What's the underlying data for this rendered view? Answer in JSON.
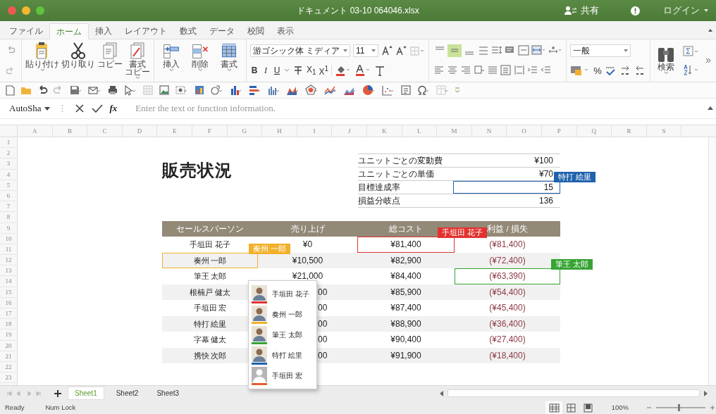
{
  "window": {
    "title": "ドキュメント 03-10 064046.xlsx",
    "share": "共有",
    "login": "ログイン"
  },
  "menu_tabs": [
    {
      "label": "ファイル",
      "selected": false
    },
    {
      "label": "ホーム",
      "selected": true
    },
    {
      "label": "挿入",
      "selected": false
    },
    {
      "label": "レイアウト",
      "selected": false
    },
    {
      "label": "数式",
      "selected": false
    },
    {
      "label": "データ",
      "selected": false
    },
    {
      "label": "校閲",
      "selected": false
    },
    {
      "label": "表示",
      "selected": false
    }
  ],
  "ribbon": {
    "clipboard": [
      {
        "lines": [
          "貼り付け"
        ]
      },
      {
        "lines": [
          "切り取り"
        ]
      },
      {
        "lines": [
          "コピー"
        ]
      },
      {
        "lines": [
          "書式",
          "コピー"
        ]
      }
    ],
    "cells": [
      "挿入",
      "削除",
      "書式"
    ],
    "font": {
      "name": "游ゴシック体 ミディア",
      "size": "11"
    },
    "text_format": [
      "B",
      "I",
      "U"
    ],
    "script_format": [
      "X$_{1}$",
      "X$^{1}$"
    ],
    "vertical_align": [
      {
        "selected": false
      },
      {
        "selected": true
      },
      {
        "selected": false
      }
    ],
    "number_format": "一般",
    "percent": "%",
    "find": "検索"
  },
  "formula_bar": {
    "name_box": "AutoSha",
    "fx": "fx",
    "placeholder": "Enter the text or function information."
  },
  "columns": [
    "A",
    "B",
    "C",
    "D",
    "E",
    "F",
    "G",
    "H",
    "I",
    "J",
    "K",
    "L",
    "M",
    "N",
    "O",
    "P",
    "Q",
    "R",
    "S"
  ],
  "rows": [
    "1",
    "2",
    "3",
    "4",
    "5",
    "6",
    "7",
    "8",
    "9",
    "10",
    "11",
    "12",
    "13",
    "14",
    "15",
    "16",
    "17",
    "18",
    "19",
    "20",
    "21",
    "22",
    "23"
  ],
  "sheet": {
    "title": "販売状況",
    "info": [
      {
        "label": "ユニットごとの変動費",
        "value": "¥100"
      },
      {
        "label": "ユニットごとの単価",
        "value": "¥70"
      },
      {
        "label": "目標達成率",
        "value": "15",
        "editor": {
          "name": "特打 絵里",
          "color": "#1e62ad"
        }
      },
      {
        "label": "損益分岐点",
        "value": "136"
      }
    ],
    "table": {
      "columns": [
        "セールスパーソン",
        "売り上げ",
        "総コスト",
        "利益 / 損失"
      ],
      "rows": [
        [
          {
            "text": "手垣田 花子"
          },
          {
            "text": "¥0"
          },
          {
            "text": "¥81,400",
            "editor": {
              "name": "手垣田 花子",
              "color": "#e2322f"
            }
          },
          {
            "text": "(¥81,400)"
          }
        ],
        [
          {
            "text": "奏州 一郎",
            "editor": {
              "name": "奏州 一郎",
              "color": "#f2b12c"
            }
          },
          {
            "text": "¥10,500"
          },
          {
            "text": "¥82,900"
          },
          {
            "text": "(¥72,400)"
          }
        ],
        [
          {
            "text": "筆王 太郎"
          },
          {
            "text": "¥21,000"
          },
          {
            "text": "¥84,400"
          },
          {
            "text": "(¥63,390)",
            "editor": {
              "name": "筆王 太郎",
              "color": "#36a433"
            }
          }
        ],
        [
          {
            "text": "根楠戸 健太"
          },
          {
            "text": "00",
            "clipped": true
          },
          {
            "text": "¥85,900"
          },
          {
            "text": "(¥54,400)"
          }
        ],
        [
          {
            "text": "手垣田 宏"
          },
          {
            "text": "00",
            "clipped": true
          },
          {
            "text": "¥87,400"
          },
          {
            "text": "(¥45,400)"
          }
        ],
        [
          {
            "text": "特打 絵里"
          },
          {
            "text": "00",
            "clipped": true
          },
          {
            "text": "¥88,900"
          },
          {
            "text": "(¥36,400)"
          }
        ],
        [
          {
            "text": "字幕 健太"
          },
          {
            "text": "00",
            "clipped": true
          },
          {
            "text": "¥90,400"
          },
          {
            "text": "(¥27,400)"
          }
        ],
        [
          {
            "text": "携快 次郎"
          },
          {
            "text": "00",
            "clipped": true
          },
          {
            "text": "¥91,900"
          },
          {
            "text": "(¥18,400)"
          }
        ]
      ]
    }
  },
  "mention_list": [
    {
      "name": "手垣田 花子",
      "color": "#e2322f",
      "kind": "photo"
    },
    {
      "name": "奏州 一郎",
      "color": "#f2b12c",
      "kind": "photo"
    },
    {
      "name": "筆王 太郎",
      "color": "#36a433",
      "kind": "photo"
    },
    {
      "name": "特打 絵里",
      "color": "#1e62ad",
      "kind": "photo"
    },
    {
      "name": "手垣田 宏",
      "color": "#e2602f",
      "kind": "placeholder"
    }
  ],
  "sheet_tabs": [
    {
      "label": "Sheet1",
      "selected": true
    },
    {
      "label": "Sheet2",
      "selected": false
    },
    {
      "label": "Sheet3",
      "selected": false
    }
  ],
  "status": {
    "ready": "Ready",
    "num_lock": "Num Lock",
    "zoom": "100%",
    "zoom_slider": {
      "level": 0.45
    }
  }
}
